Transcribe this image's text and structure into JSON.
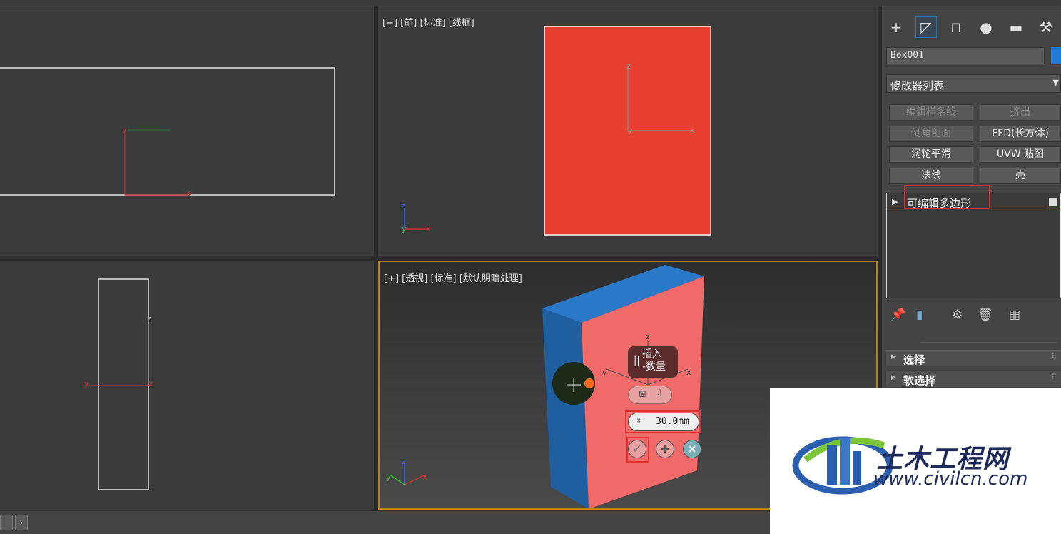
{
  "viewports": {
    "front_label": "[+] [前] [标准] [线框]",
    "persp_label": "[+] [透视] [标准] [默认明暗处理]"
  },
  "axes": {
    "x": "x",
    "y": "y",
    "z": "z"
  },
  "panel": {
    "tabs": [
      "create-icon",
      "modify-icon",
      "hierarchy-icon",
      "motion-icon",
      "display-icon",
      "utilities-icon"
    ],
    "object_name": "Box001",
    "object_color": "#1f7bd6",
    "modifier_list": "修改器列表",
    "modifier_buttons": [
      "编辑样条线",
      "挤出",
      "倒角剖面",
      "FFD(长方体)",
      "涡轮平滑",
      "UVW 贴图",
      "法线",
      "壳"
    ],
    "stack_item": "可编辑多边形",
    "rollouts": [
      "选择",
      "软选择"
    ]
  },
  "caddy": {
    "title_line1": "插入",
    "title_line2": "-数量",
    "value": "30.0mm",
    "ok_icon": "✓",
    "apply_icon": "+",
    "cancel_icon": "×"
  },
  "watermark": {
    "brand": "土木工程网",
    "url": "www.civilcn.com"
  },
  "colors": {
    "selection_red": "#e84030",
    "highlight_box": "#e03030",
    "active_border": "#b8860b",
    "box_blue": "#1f5fa0",
    "face_pink": "#f06a6a"
  }
}
